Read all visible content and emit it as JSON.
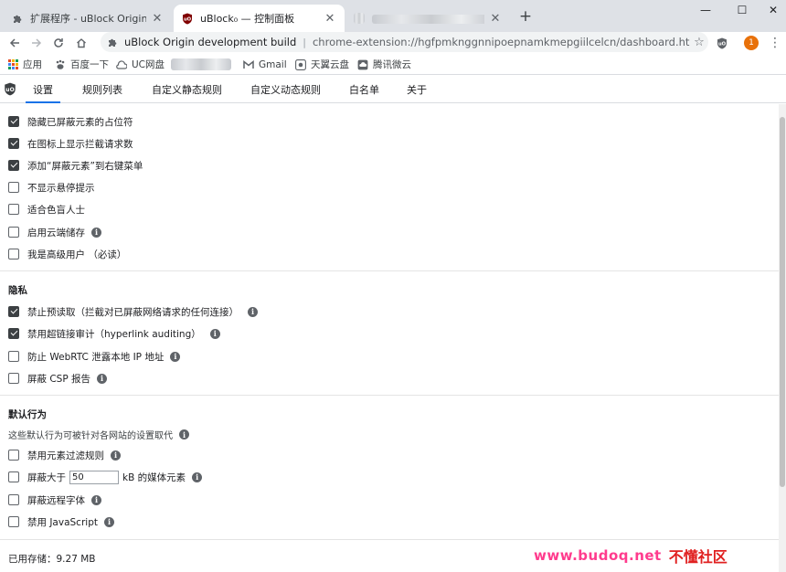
{
  "browser": {
    "tabs": [
      {
        "title": "扩展程序 - uBlock Origin devel",
        "icon": "puzzle-icon",
        "active": false
      },
      {
        "title": "uBlock₀ — 控制面板",
        "icon": "ublock-icon",
        "active": true
      },
      {
        "title": "",
        "icon": "blurred-favicon",
        "active": false
      }
    ],
    "new_tab_label": "+",
    "window": {
      "minimize": "—",
      "maximize": "☐",
      "close": "✕"
    },
    "omnibox": {
      "site_name": "uBlock Origin development build",
      "url": "chrome-extension://hgfpmknggnnipoepnamkmepgiilcelcn/dashboard.html#sett..."
    },
    "profile_initial": "1",
    "bookmarks": [
      {
        "label": "应用",
        "icon": "apps-grid-icon"
      },
      {
        "label": "百度一下",
        "icon": "baidu-icon"
      },
      {
        "label": "UC网盘",
        "icon": "cloud-icon"
      },
      {
        "label": "",
        "icon": "blurred-bookmark"
      },
      {
        "label": "Gmail",
        "icon": "gmail-icon"
      },
      {
        "label": "天翼云盘",
        "icon": "tianyi-icon"
      },
      {
        "label": "腾讯微云",
        "icon": "weiyun-icon"
      }
    ]
  },
  "dashboard": {
    "tabs": [
      {
        "label": "设置",
        "selected": true
      },
      {
        "label": "规则列表",
        "selected": false
      },
      {
        "label": "自定义静态规则",
        "selected": false
      },
      {
        "label": "自定义动态规则",
        "selected": false
      },
      {
        "label": "白名单",
        "selected": false
      },
      {
        "label": "关于",
        "selected": false
      }
    ]
  },
  "settings": {
    "appearance": [
      {
        "label": "隐藏已屏蔽元素的占位符",
        "checked": true,
        "info": false
      },
      {
        "label": "在图标上显示拦截请求数",
        "checked": true,
        "info": false
      },
      {
        "label": "添加“屏蔽元素”到右键菜单",
        "checked": true,
        "info": false
      },
      {
        "label": "不显示悬停提示",
        "checked": false,
        "info": false
      },
      {
        "label": "适合色盲人士",
        "checked": false,
        "info": false
      },
      {
        "label": "启用云端储存",
        "checked": false,
        "info": true
      },
      {
        "label": "我是高级用户 （必读）",
        "checked": false,
        "info": false
      }
    ],
    "privacy": {
      "title": "隐私",
      "items": [
        {
          "label": "禁止预读取（拦截对已屏蔽网络请求的任何连接）",
          "checked": true,
          "info": true
        },
        {
          "label": "禁用超链接审计（hyperlink auditing）",
          "checked": true,
          "info": true
        },
        {
          "label": "防止 WebRTC 泄露本地 IP 地址",
          "checked": false,
          "info": true
        },
        {
          "label": "屏蔽 CSP 报告",
          "checked": false,
          "info": true
        }
      ]
    },
    "defaults": {
      "title": "默认行为",
      "note": "这些默认行为可被针对各网站的设置取代",
      "filter_label": "禁用元素过滤规则",
      "media_prefix": "屏蔽大于",
      "media_value": "50",
      "media_suffix": "kB 的媒体元素",
      "fonts_label": "屏蔽远程字体",
      "js_label": "禁用 JavaScript"
    },
    "storage": "已用存储：9.27 MB"
  },
  "watermark": {
    "url": "www.budoq.net",
    "name": "不懂社区"
  },
  "info_glyph": "i"
}
